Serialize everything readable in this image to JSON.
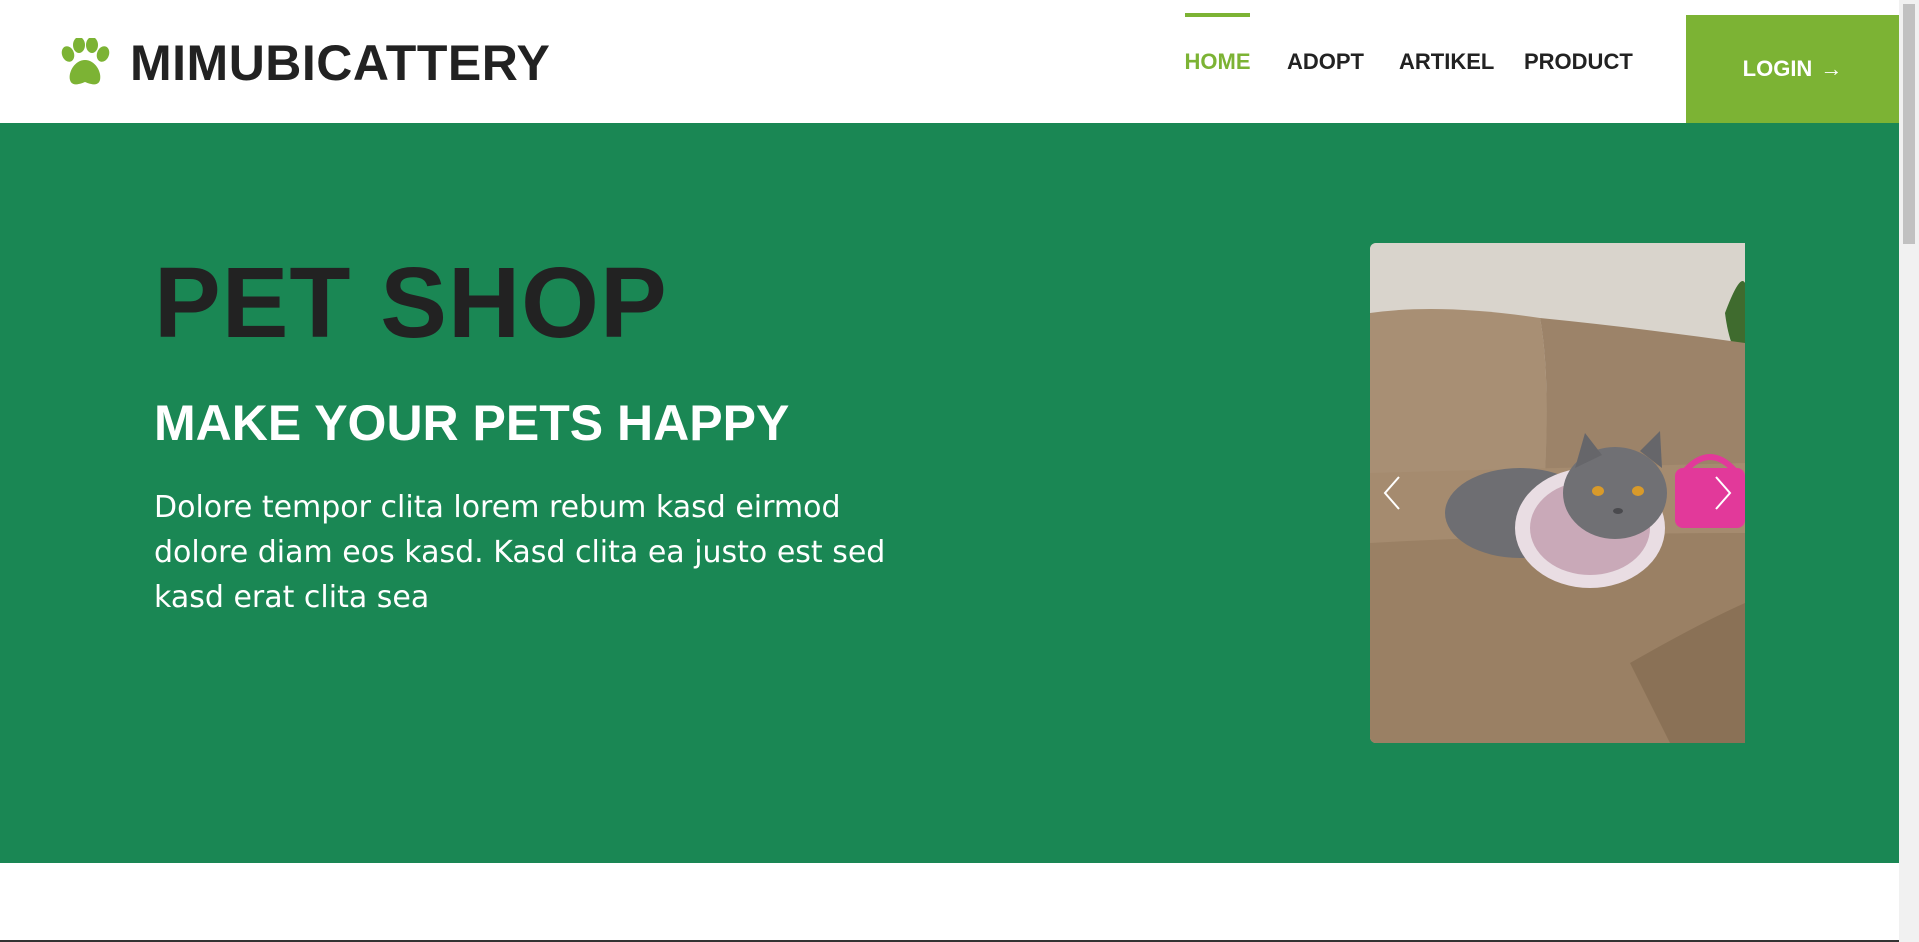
{
  "brand": {
    "name": "MIMUBICATTERY",
    "icon": "paw-icon",
    "color": "#7cb334"
  },
  "nav": {
    "items": [
      {
        "label": "HOME",
        "active": true
      },
      {
        "label": "ADOPT",
        "active": false
      },
      {
        "label": "ARTIKEL",
        "active": false
      },
      {
        "label": "PRODUCT",
        "active": false
      }
    ],
    "login_label": "LOGIN",
    "login_icon": "arrow-right-icon"
  },
  "hero": {
    "title": "PET SHOP",
    "subtitle": "MAKE YOUR PETS HAPPY",
    "text": "Dolore tempor clita lorem rebum kasd eirmod dolore diam eos kasd. Kasd clita ea justo est sed kasd erat clita sea",
    "background": "#1a8754"
  },
  "carousel": {
    "prev_icon": "chevron-left-icon",
    "next_icon": "chevron-right-icon",
    "image": "cat-with-ruffled-collar-on-sofa"
  }
}
